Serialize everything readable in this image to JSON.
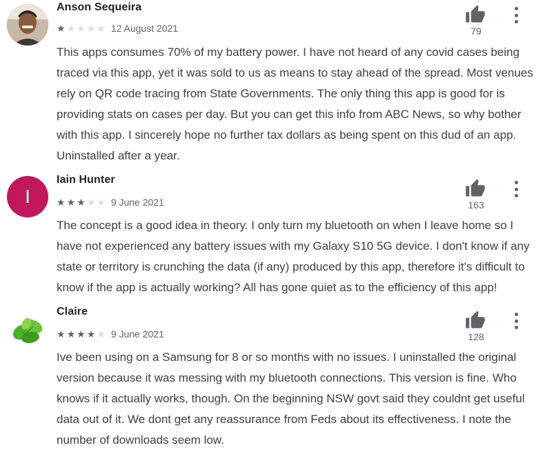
{
  "reviews": [
    {
      "name": "Anson Sequeira",
      "rating": 1,
      "date": "12 August 2021",
      "helpful_count": "79",
      "avatar_icon": "profile-photo",
      "text": "This apps consumes 70% of my battery power. I have not heard of any covid cases being traced via this app, yet it was sold to us as means to stay ahead of the spread. Most venues rely on QR code tracing from State Governments. The only thing this app is good for is providing stats on cases per day. But you can get this info from ABC News, so why bother with this app. I sincerely hope no further tax dollars as being spent on this dud of an app. Uninstalled after a year."
    },
    {
      "name": "Iain Hunter",
      "rating": 3,
      "date": "9 June 2021",
      "helpful_count": "163",
      "avatar_letter": "I",
      "avatar_color": "#c2185b",
      "text": "The concept is a good idea in theory. I only turn my bluetooth on when I leave home so I have not experienced any battery issues with my Galaxy S10 5G device. I don't know if any state or territory is crunching the data (if any) produced by this app, therefore it's difficult to know if the app is actually working? All has gone quiet as to the efficiency of this app!"
    },
    {
      "name": "Claire",
      "rating": 4,
      "date": "9 June 2021",
      "helpful_count": "128",
      "avatar_icon": "leaf-photo",
      "text": "Ive been using on a Samsung for 8 or so months with no issues. I uninstalled the original version because it was messing with my bluetooth connections. This version is fine. Who knows if it actually works, though. On the beginning NSW govt said they couldnt get useful data out of it. We dont get any reassurance from Feds about its effectiveness. I note the number of downloads seem low."
    }
  ],
  "colors": {
    "star_filled": "#5f6368",
    "star_empty": "#dadce0",
    "text": "#3c4043",
    "name": "#202124"
  }
}
